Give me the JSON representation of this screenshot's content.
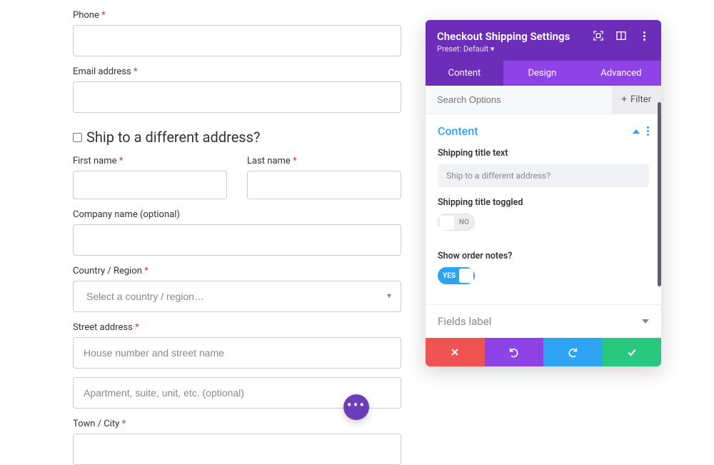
{
  "form": {
    "phone_label": "Phone",
    "email_label": "Email address",
    "ship_heading": "Ship to a different address?",
    "first_name_label": "First name",
    "last_name_label": "Last name",
    "company_label": "Company name (optional)",
    "country_label": "Country / Region",
    "country_placeholder": "Select a country / region…",
    "street_label": "Street address",
    "street_placeholder": "House number and street name",
    "street2_placeholder": "Apartment, suite, unit, etc. (optional)",
    "city_label": "Town / City",
    "required_mark": "*"
  },
  "panel": {
    "title": "Checkout Shipping Settings",
    "preset_label": "Preset: Default",
    "tabs": {
      "content": "Content",
      "design": "Design",
      "advanced": "Advanced"
    },
    "search_placeholder": "Search Options",
    "filter_label": "Filter",
    "section_title": "Content",
    "shipping_title_text_label": "Shipping title text",
    "shipping_title_text_value": "Ship to a different address?",
    "shipping_title_toggled_label": "Shipping title toggled",
    "toggle_no": "NO",
    "show_order_notes_label": "Show order notes?",
    "toggle_yes": "YES",
    "fields_label_section": "Fields label"
  }
}
